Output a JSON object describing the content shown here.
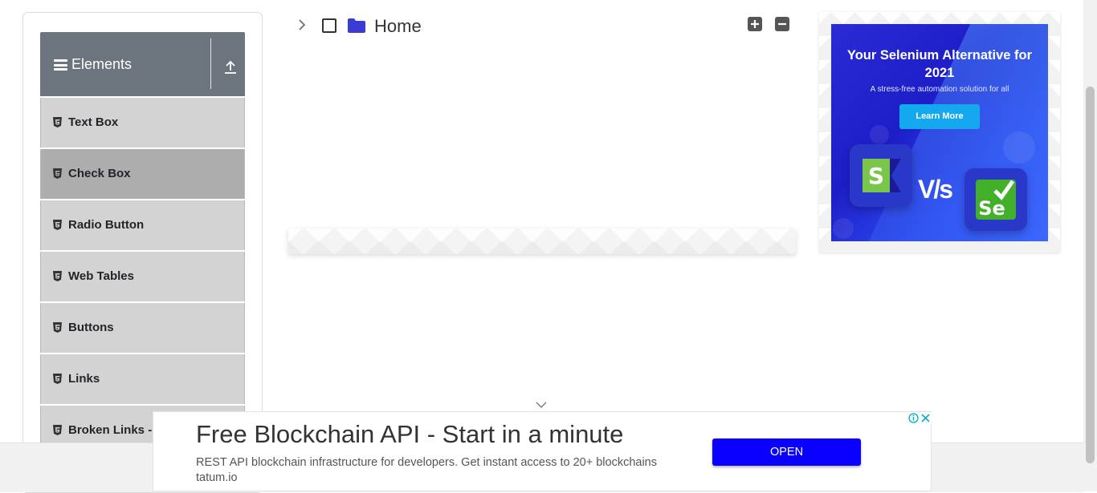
{
  "sidebar": {
    "group_title": "Elements",
    "items": [
      {
        "label": "Text Box",
        "active": false
      },
      {
        "label": "Check Box",
        "active": true
      },
      {
        "label": "Radio Button",
        "active": false
      },
      {
        "label": "Web Tables",
        "active": false
      },
      {
        "label": "Buttons",
        "active": false
      },
      {
        "label": "Links",
        "active": false
      },
      {
        "label": "Broken Links - Images",
        "active": false
      }
    ]
  },
  "tree": {
    "root_label": "Home",
    "checked": false,
    "expanded": false
  },
  "right_ad": {
    "headline": "Your Selenium Alternative for 2021",
    "subtext": "A stress-free automation solution for all",
    "cta": "Learn More",
    "vs_text": "V/s",
    "logo_left_letter": "S",
    "logo_right_letters": "Se"
  },
  "bottom_ad": {
    "title": "Free Blockchain API - Start in a minute",
    "description": "REST API blockchain infrastructure for developers. Get instant access to 20+ blockchains tatum.io",
    "button": "OPEN"
  },
  "colors": {
    "sidebar_header": "#6c757d",
    "menu_item": "#d3d3d3",
    "menu_item_active": "#adadad",
    "open_button": "#0a00ff",
    "ad_blue": "#2a2bd4"
  }
}
